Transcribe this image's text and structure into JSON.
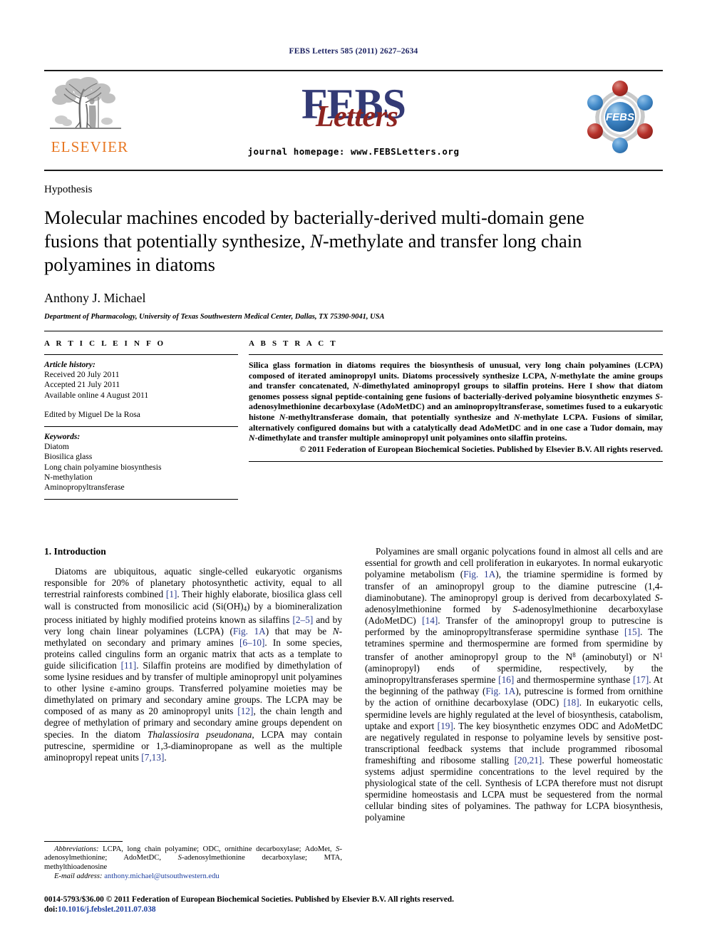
{
  "running_head": "FEBS Letters 585 (2011) 2627–2634",
  "masthead": {
    "elsevier_word": "ELSEVIER",
    "febs_big": "FEBS",
    "febs_script": "Letters",
    "homepage": "journal homepage: www.FEBSLetters.org",
    "febs_circle_text": "FEBS",
    "colors": {
      "elsevier_orange": "#E87722",
      "febs_navy": "#333a75",
      "letters_red": "#8e2420",
      "circle_blue": "#3b82c4",
      "circle_red": "#b8322b",
      "circle_gray": "#c8c8c8",
      "running_head_navy": "#1a2060"
    }
  },
  "article": {
    "type_label": "Hypothesis",
    "title_part1": "Molecular machines encoded by bacterially-derived multi-domain gene fusions that potentially synthesize, ",
    "title_italic": "N",
    "title_part2": "-methylate and transfer long chain polyamines in diatoms",
    "author": "Anthony J. Michael",
    "affiliation": "Department of Pharmacology, University of Texas Southwestern Medical Center, Dallas, TX 75390-9041, USA"
  },
  "article_info": {
    "heading": "A R T I C L E    I N F O",
    "history_label": "Article history:",
    "received": "Received 20 July 2011",
    "accepted": "Accepted 21 July 2011",
    "available": "Available online 4 August 2011",
    "edited_by": "Edited by Miguel De la Rosa",
    "keywords_label": "Keywords:",
    "keywords": [
      "Diatom",
      "Biosilica glass",
      "Long chain polyamine biosynthesis",
      "N-methylation",
      "Aminopropyltransferase"
    ]
  },
  "abstract": {
    "heading": "A B S T R A C T",
    "text_html": "Silica glass formation in diatoms requires the biosynthesis of unusual, very long chain polyamines (LCPA) composed of iterated aminopropyl units. Diatoms processively synthesize LCPA, <i>N</i>-methylate the amine groups and transfer concatenated, <i>N</i>-dimethylated aminopropyl groups to silaffin proteins. Here I show that diatom genomes possess signal peptide-containing gene fusions of bacterially-derived polyamine biosynthetic enzymes <i>S</i>-adenosylmethionine decarboxylase (AdoMetDC) and an aminopropyltransferase, sometimes fused to a eukaryotic histone <i>N</i>-methyltransferase domain, that potentially synthesize and <i>N</i>-methylate LCPA. Fusions of similar, alternatively configured domains but with a catalytically dead AdoMetDC and in one case a Tudor domain, may <i>N</i>-dimethylate and transfer multiple aminopropyl unit polyamines onto silaffin proteins.",
    "copyright": "© 2011 Federation of European Biochemical Societies. Published by Elsevier B.V. All rights reserved."
  },
  "body": {
    "intro_heading": "1. Introduction",
    "left_paragraph_html": "Diatoms are ubiquitous, aquatic single-celled eukaryotic organisms responsible for 20% of planetary photosynthetic activity, equal to all terrestrial rainforests combined <span class=\"lnk\">[1]</span>. Their highly elaborate, biosilica glass cell wall is constructed from monosilicic acid (Si(OH)<sub>4</sub>) by a biomineralization process initiated by highly modified proteins known as silaffins <span class=\"lnk\">[2–5]</span> and by very long chain linear polyamines (LCPA) (<span class=\"lnk\">Fig. 1A</span>) that may be <i>N</i>-methylated on secondary and primary amines <span class=\"lnk\">[6–10]</span>. In some species, proteins called cingulins form an organic matrix that acts as a template to guide silicification <span class=\"lnk\">[11]</span>. Silaffin proteins are modified by dimethylation of some lysine residues and by transfer of multiple aminopropyl unit polyamines to other lysine ε-amino groups. Transferred polyamine moieties may be dimethylated on primary and secondary amine groups. The LCPA may be composed of as many as 20 aminopropyl units <span class=\"lnk\">[12]</span>, the chain length and degree of methylation of primary and secondary amine groups dependent on species. In the diatom <i>Thalassiosira pseudonana</i>, LCPA may contain putrescine, spermidine or 1,3-diaminopropane as well as the multiple aminopropyl repeat units <span class=\"lnk\">[7,13]</span>.",
    "right_paragraph_html": "Polyamines are small organic polycations found in almost all cells and are essential for growth and cell proliferation in eukaryotes. In normal eukaryotic polyamine metabolism (<span class=\"lnk\">Fig. 1A</span>), the triamine spermidine is formed by transfer of an aminopropyl group to the diamine putrescine (1,4-diaminobutane). The aminopropyl group is derived from decarboxylated <i>S</i>-adenosylmethionine formed by <i>S</i>-adenosylmethionine decarboxylase (AdoMetDC) <span class=\"lnk\">[14]</span>. Transfer of the aminopropyl group to putrescine is performed by the aminopropyltransferase spermidine synthase <span class=\"lnk\">[15]</span>. The tetramines spermine and thermospermine are formed from spermidine by transfer of another aminopropyl group to the N<sup>8</sup> (aminobutyl) or N<sup>1</sup> (aminopropyl) ends of spermidine, respectively, by the aminopropyltransferases spermine <span class=\"lnk\">[16]</span> and thermospermine synthase <span class=\"lnk\">[17]</span>. At the beginning of the pathway (<span class=\"lnk\">Fig. 1A</span>), putrescine is formed from ornithine by the action of ornithine decarboxylase (ODC) <span class=\"lnk\">[18]</span>. In eukaryotic cells, spermidine levels are highly regulated at the level of biosynthesis, catabolism, uptake and export <span class=\"lnk\">[19]</span>. The key biosynthetic enzymes ODC and AdoMetDC are negatively regulated in response to polyamine levels by sensitive post-transcriptional feedback systems that include programmed ribosomal frameshifting and ribosome stalling <span class=\"lnk\">[20,21]</span>. These powerful homeostatic systems adjust spermidine concentrations to the level required by the physiological state of the cell. Synthesis of LCPA therefore must not disrupt spermidine homeostasis and LCPA must be sequestered from the normal cellular binding sites of polyamines. The pathway for LCPA biosynthesis, polyamine"
  },
  "footnote": {
    "abbreviations_html": "<span class=\"fn-indent\"><span class=\"ital\">Abbreviations:</span> LCPA, long chain polyamine; ODC, ornithine decarboxylase; AdoMet, <span class=\"ital\">S</span>-adenosylmethionine; AdoMetDC, <span class=\"ital\">S</span>-adenosylmethionine decarboxylase; MTA, methylthioadenosine</span>",
    "email_label": "E-mail address:",
    "email": "anthony.michael@utsouthwestern.edu"
  },
  "page_footer": {
    "line1": "0014-5793/$36.00 © 2011 Federation of European Biochemical Societies. Published by Elsevier B.V. All rights reserved.",
    "doi_prefix": "doi:",
    "doi": "10.1016/j.febslet.2011.07.038"
  }
}
